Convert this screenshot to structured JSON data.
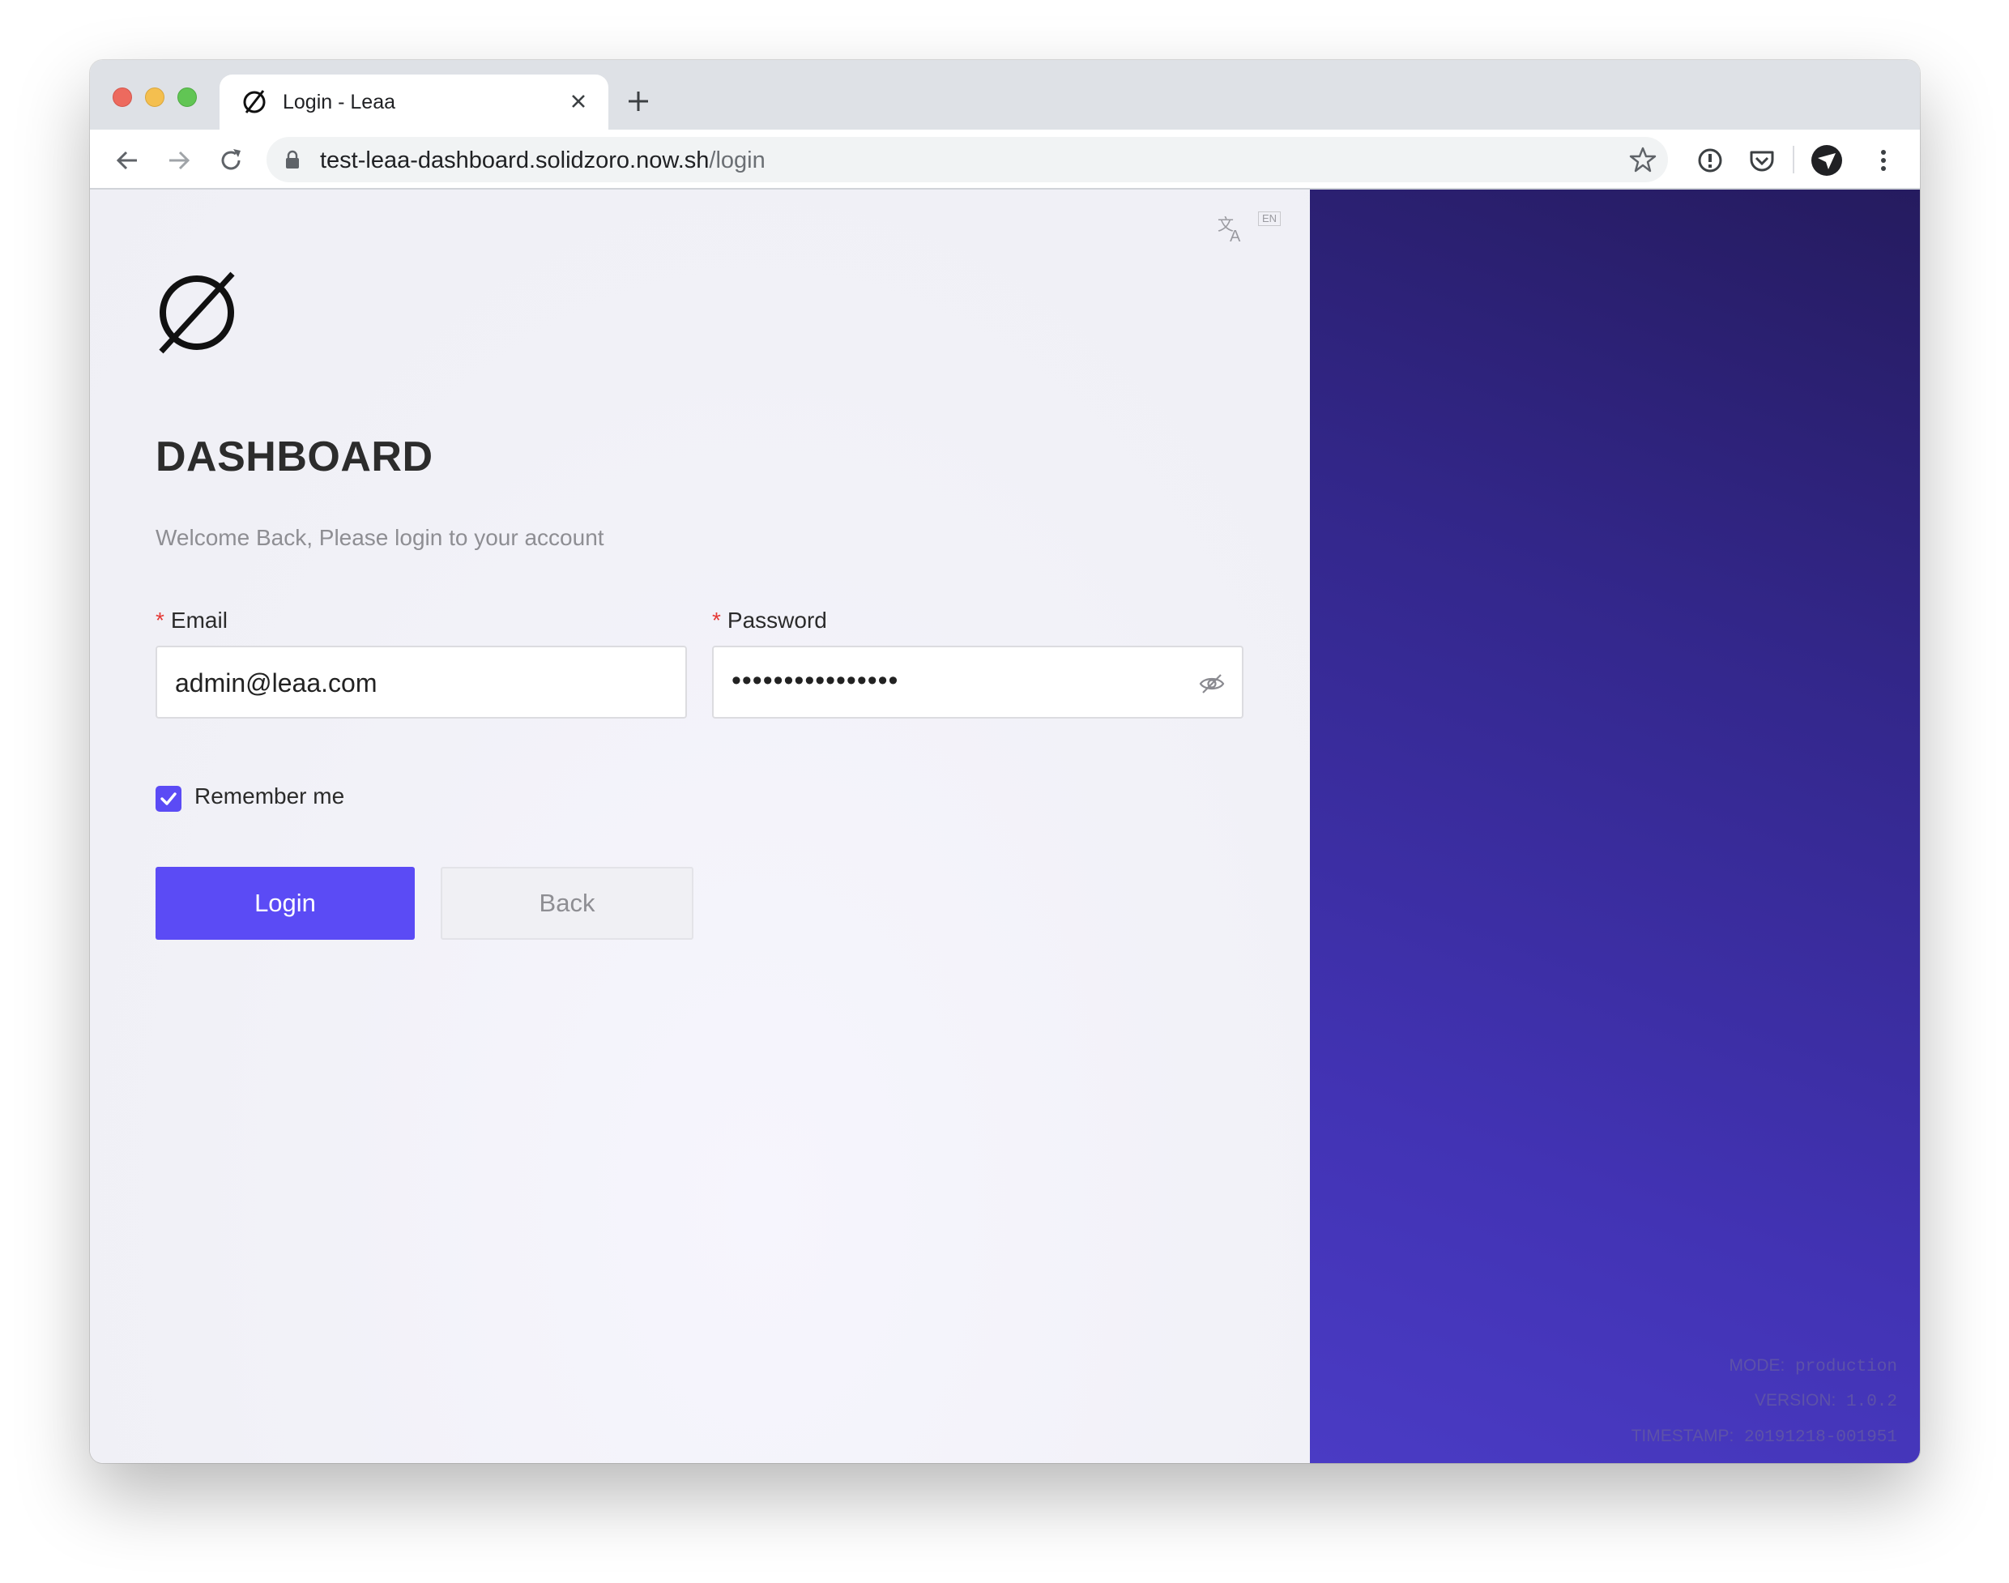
{
  "browser": {
    "tab_title": "Login - Leaa",
    "url_host": "test-leaa-dashboard.solidzoro.now.sh",
    "url_path": "/login"
  },
  "language": {
    "badge": "EN",
    "icon": "translate-icon"
  },
  "login": {
    "title": "DASHBOARD",
    "subtitle": "Welcome Back, Please login to your account",
    "email_label": "Email",
    "email_value": "admin@leaa.com",
    "password_label": "Password",
    "password_dots": "••••••••••••••••",
    "required_mark": "*",
    "remember_label": "Remember me",
    "remember_checked": true,
    "login_button": "Login",
    "back_button": "Back"
  },
  "build_info": {
    "mode_label": "MODE:",
    "mode_value": "production",
    "version_label": "VERSION:",
    "version_value": "1.0.2",
    "timestamp_label": "TIMESTAMP:",
    "timestamp_value": "20191218-001951"
  },
  "colors": {
    "accent": "#5b4bf5",
    "panel_dark": "#251b5f",
    "panel_light": "#4a3bc4",
    "required": "#e53935"
  }
}
